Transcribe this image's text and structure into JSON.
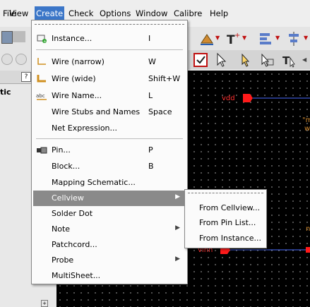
{
  "menubar": {
    "items": [
      {
        "label": "File",
        "mnemonic": "F"
      },
      {
        "label": "View",
        "mnemonic": "V"
      },
      {
        "label": "Create",
        "mnemonic": "C"
      },
      {
        "label": "Check",
        "mnemonic": "k"
      },
      {
        "label": "Options",
        "mnemonic": "O"
      },
      {
        "label": "Window",
        "mnemonic": "W"
      },
      {
        "label": "Calibre",
        "mnemonic": "b"
      },
      {
        "label": "Help",
        "mnemonic": "H"
      }
    ],
    "active": "Create"
  },
  "left_panel": {
    "help_badge": "?",
    "partial_text": "tic"
  },
  "create_menu": {
    "items": [
      {
        "label": "Instance...",
        "shortcut": "I",
        "icon": "instance-icon"
      },
      {
        "label": "Wire (narrow)",
        "shortcut": "W",
        "icon": "wire-narrow-icon"
      },
      {
        "label": "Wire (wide)",
        "shortcut": "Shift+W",
        "icon": "wire-wide-icon"
      },
      {
        "label": "Wire Name...",
        "shortcut": "L",
        "icon": "wire-name-icon"
      },
      {
        "label": "Wire Stubs and Names",
        "shortcut": "Space",
        "icon": ""
      },
      {
        "label": "Net Expression...",
        "shortcut": "",
        "icon": ""
      },
      {
        "label": "Pin...",
        "shortcut": "P",
        "icon": "pin-icon"
      },
      {
        "label": "Block...",
        "shortcut": "B",
        "icon": ""
      },
      {
        "label": "Mapping Schematic...",
        "shortcut": "",
        "icon": ""
      },
      {
        "label": "Cellview",
        "shortcut": "",
        "submenu": true,
        "highlighted": true
      },
      {
        "label": "Solder Dot",
        "shortcut": "",
        "icon": ""
      },
      {
        "label": "Note",
        "shortcut": "",
        "submenu": true
      },
      {
        "label": "Patchcord...",
        "shortcut": "",
        "icon": ""
      },
      {
        "label": "Probe",
        "shortcut": "",
        "submenu": true
      },
      {
        "label": "MultiSheet...",
        "shortcut": "",
        "icon": ""
      }
    ]
  },
  "cellview_submenu": {
    "items": [
      "From Cellview...",
      "From Pin List...",
      "From Instance..."
    ]
  },
  "canvas": {
    "net_labels": [
      "vdd",
      "vinn"
    ],
    "partial_texts": [
      "\"m",
      "w",
      "n"
    ]
  },
  "colors": {
    "menu_highlight": "#8a8a8a",
    "menubar_active": "#3b76c8",
    "net_label": "#ff3030",
    "wire": "#4a6cff"
  }
}
